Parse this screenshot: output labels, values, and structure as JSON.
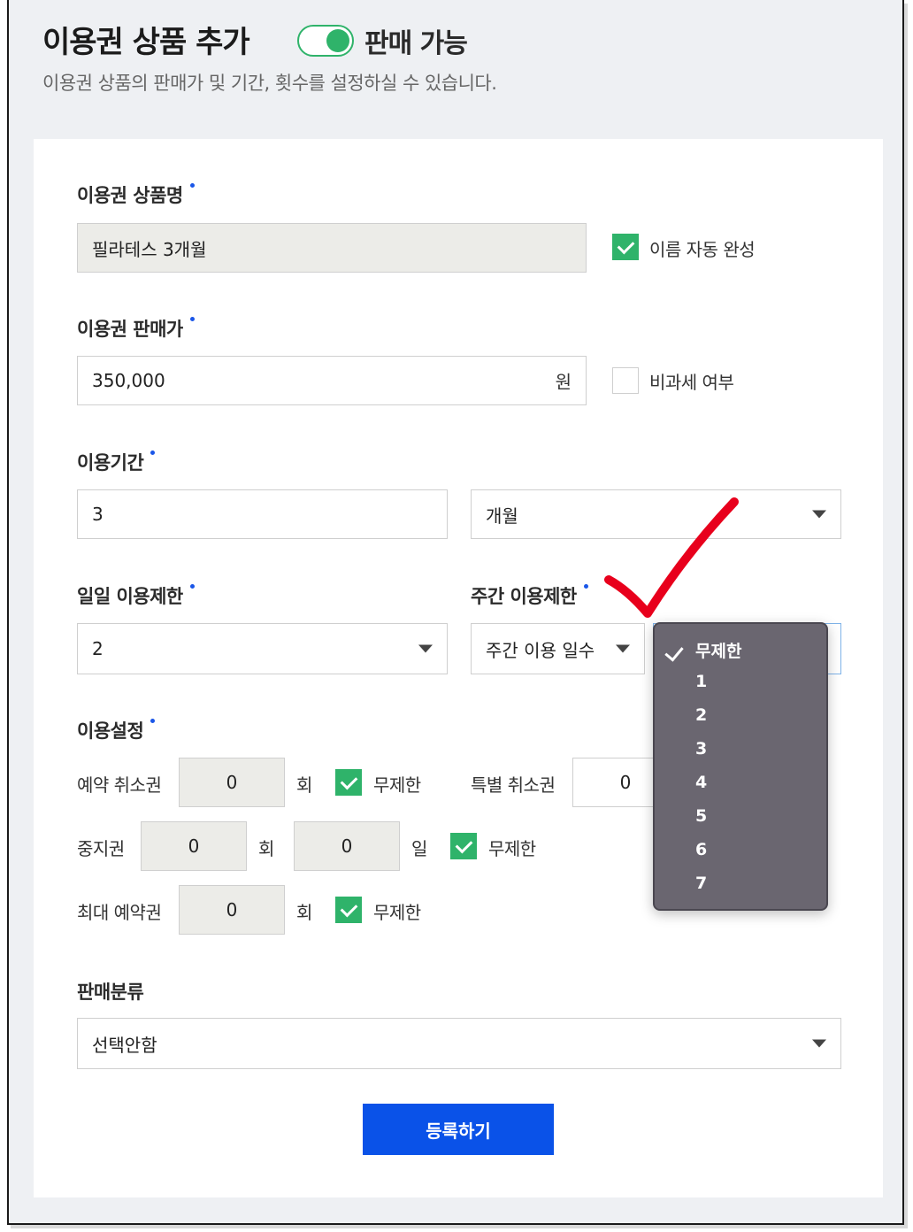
{
  "header": {
    "title": "이용권 상품 추가",
    "toggle_label": "판매 가능",
    "toggle_on": true,
    "subtitle": "이용권 상품의 판매가 및 기간, 횟수를 설정하실 수 있습니다."
  },
  "form": {
    "name": {
      "label": "이용권 상품명",
      "value": "필라테스 3개월",
      "autocomplete_label": "이름 자동 완성",
      "autocomplete_checked": true
    },
    "price": {
      "label": "이용권 판매가",
      "value": "350,000",
      "unit": "원",
      "taxfree_label": "비과세 여부",
      "taxfree_checked": false
    },
    "period": {
      "label": "이용기간",
      "value": "3",
      "unit_select": "개월"
    },
    "daily_limit": {
      "label": "일일 이용제한",
      "value": "2"
    },
    "weekly_limit": {
      "label": "주간 이용제한",
      "select": "주간 이용 일수"
    },
    "settings": {
      "label": "이용설정",
      "cancel": {
        "label": "예약 취소권",
        "value": "0",
        "unit": "회",
        "unlimited_label": "무제한",
        "unlimited_checked": true
      },
      "special_cancel": {
        "label": "특별 취소권",
        "value": "0"
      },
      "pause": {
        "label": "중지권",
        "count": "0",
        "count_unit": "회",
        "days": "0",
        "days_unit": "일",
        "unlimited_label": "무제한",
        "unlimited_checked": true
      },
      "max_reserve": {
        "label": "최대 예약권",
        "value": "0",
        "unit": "회",
        "unlimited_label": "무제한",
        "unlimited_checked": true
      }
    },
    "category": {
      "label": "판매분류",
      "value": "선택안함"
    },
    "submit_label": "등록하기"
  },
  "dropdown": {
    "selected": "무제한",
    "options": [
      "무제한",
      "1",
      "2",
      "3",
      "4",
      "5",
      "6",
      "7"
    ]
  },
  "colors": {
    "accent": "#0a52e8",
    "check_green": "#2fb36a",
    "annotation_red": "#e8001c",
    "menu_bg": "#6a6670"
  }
}
